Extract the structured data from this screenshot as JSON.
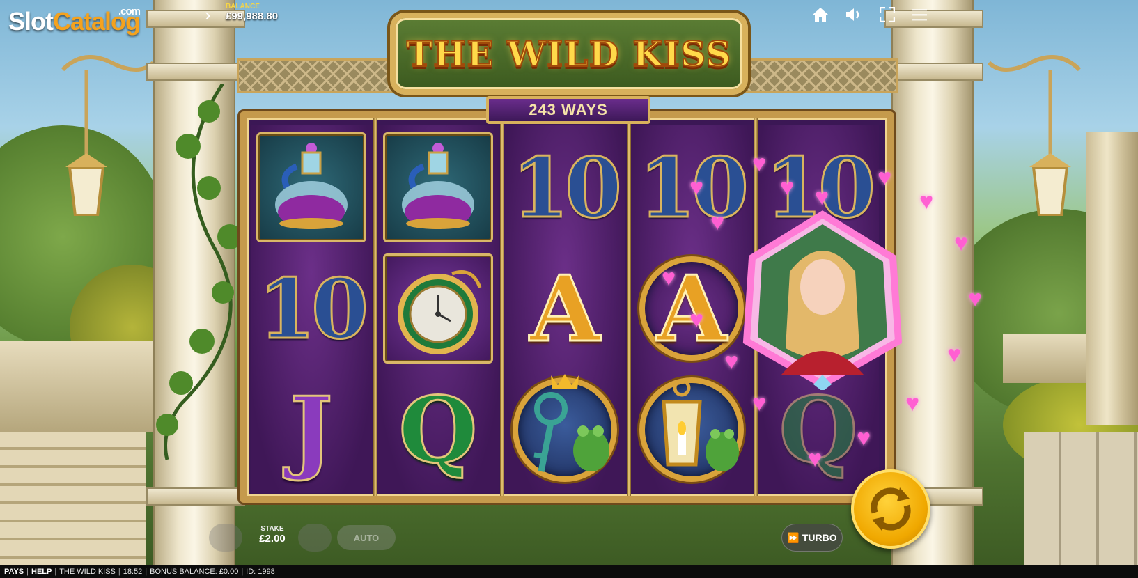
{
  "branding": {
    "logo_part1": "Slot",
    "logo_part2": "Catalog",
    "logo_suffix": ".com"
  },
  "header": {
    "balance_label": "BALANCE",
    "balance_value": "£99,988.80",
    "menu_icon": "chevron-right-icon"
  },
  "top_icons": [
    "home-icon",
    "sound-icon",
    "fullscreen-icon",
    "menu-icon"
  ],
  "game": {
    "title": "THE WILD KISS",
    "ways": "243 WAYS"
  },
  "reels": [
    [
      "potion",
      "10",
      "J"
    ],
    [
      "potion",
      "pocket-watch",
      "Q"
    ],
    [
      "10",
      "A",
      "key-frog"
    ],
    [
      "10",
      "A",
      "lantern-frog"
    ],
    [
      "10",
      "princess-wild",
      "Q"
    ]
  ],
  "symbol_text": {
    "ten": "10",
    "ace": "A",
    "jack": "J",
    "queen": "Q"
  },
  "controls": {
    "stake_label": "STAKE",
    "stake_value": "£2.00",
    "auto_label": "AUTO",
    "turbo_label": "TURBO"
  },
  "footer": {
    "pays": "PAYS",
    "help": "HELP",
    "game_name": "THE WILD KISS",
    "time": "18:52",
    "bonus_balance": "BONUS BALANCE: £0.00",
    "id": "ID: 1998"
  },
  "colors": {
    "accent_gold": "#d8b15c",
    "reel_purple": "#3f1757",
    "spin_yellow": "#f0a800",
    "heart_pink": "#ff5fd2"
  }
}
